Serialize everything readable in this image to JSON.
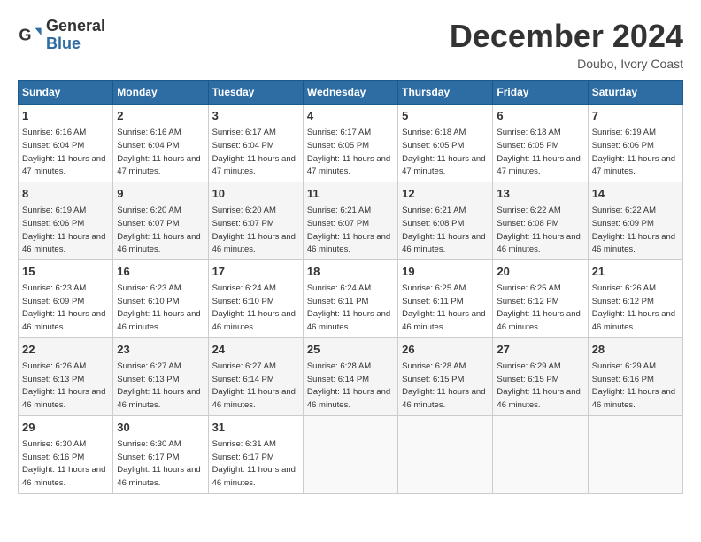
{
  "logo": {
    "line1": "General",
    "line2": "Blue"
  },
  "title": "December 2024",
  "location": "Doubo, Ivory Coast",
  "days_of_week": [
    "Sunday",
    "Monday",
    "Tuesday",
    "Wednesday",
    "Thursday",
    "Friday",
    "Saturday"
  ],
  "weeks": [
    [
      {
        "day": 1,
        "sunrise": "6:16 AM",
        "sunset": "6:04 PM",
        "daylight": "11 hours and 47 minutes."
      },
      {
        "day": 2,
        "sunrise": "6:16 AM",
        "sunset": "6:04 PM",
        "daylight": "11 hours and 47 minutes."
      },
      {
        "day": 3,
        "sunrise": "6:17 AM",
        "sunset": "6:04 PM",
        "daylight": "11 hours and 47 minutes."
      },
      {
        "day": 4,
        "sunrise": "6:17 AM",
        "sunset": "6:05 PM",
        "daylight": "11 hours and 47 minutes."
      },
      {
        "day": 5,
        "sunrise": "6:18 AM",
        "sunset": "6:05 PM",
        "daylight": "11 hours and 47 minutes."
      },
      {
        "day": 6,
        "sunrise": "6:18 AM",
        "sunset": "6:05 PM",
        "daylight": "11 hours and 47 minutes."
      },
      {
        "day": 7,
        "sunrise": "6:19 AM",
        "sunset": "6:06 PM",
        "daylight": "11 hours and 47 minutes."
      }
    ],
    [
      {
        "day": 8,
        "sunrise": "6:19 AM",
        "sunset": "6:06 PM",
        "daylight": "11 hours and 46 minutes."
      },
      {
        "day": 9,
        "sunrise": "6:20 AM",
        "sunset": "6:07 PM",
        "daylight": "11 hours and 46 minutes."
      },
      {
        "day": 10,
        "sunrise": "6:20 AM",
        "sunset": "6:07 PM",
        "daylight": "11 hours and 46 minutes."
      },
      {
        "day": 11,
        "sunrise": "6:21 AM",
        "sunset": "6:07 PM",
        "daylight": "11 hours and 46 minutes."
      },
      {
        "day": 12,
        "sunrise": "6:21 AM",
        "sunset": "6:08 PM",
        "daylight": "11 hours and 46 minutes."
      },
      {
        "day": 13,
        "sunrise": "6:22 AM",
        "sunset": "6:08 PM",
        "daylight": "11 hours and 46 minutes."
      },
      {
        "day": 14,
        "sunrise": "6:22 AM",
        "sunset": "6:09 PM",
        "daylight": "11 hours and 46 minutes."
      }
    ],
    [
      {
        "day": 15,
        "sunrise": "6:23 AM",
        "sunset": "6:09 PM",
        "daylight": "11 hours and 46 minutes."
      },
      {
        "day": 16,
        "sunrise": "6:23 AM",
        "sunset": "6:10 PM",
        "daylight": "11 hours and 46 minutes."
      },
      {
        "day": 17,
        "sunrise": "6:24 AM",
        "sunset": "6:10 PM",
        "daylight": "11 hours and 46 minutes."
      },
      {
        "day": 18,
        "sunrise": "6:24 AM",
        "sunset": "6:11 PM",
        "daylight": "11 hours and 46 minutes."
      },
      {
        "day": 19,
        "sunrise": "6:25 AM",
        "sunset": "6:11 PM",
        "daylight": "11 hours and 46 minutes."
      },
      {
        "day": 20,
        "sunrise": "6:25 AM",
        "sunset": "6:12 PM",
        "daylight": "11 hours and 46 minutes."
      },
      {
        "day": 21,
        "sunrise": "6:26 AM",
        "sunset": "6:12 PM",
        "daylight": "11 hours and 46 minutes."
      }
    ],
    [
      {
        "day": 22,
        "sunrise": "6:26 AM",
        "sunset": "6:13 PM",
        "daylight": "11 hours and 46 minutes."
      },
      {
        "day": 23,
        "sunrise": "6:27 AM",
        "sunset": "6:13 PM",
        "daylight": "11 hours and 46 minutes."
      },
      {
        "day": 24,
        "sunrise": "6:27 AM",
        "sunset": "6:14 PM",
        "daylight": "11 hours and 46 minutes."
      },
      {
        "day": 25,
        "sunrise": "6:28 AM",
        "sunset": "6:14 PM",
        "daylight": "11 hours and 46 minutes."
      },
      {
        "day": 26,
        "sunrise": "6:28 AM",
        "sunset": "6:15 PM",
        "daylight": "11 hours and 46 minutes."
      },
      {
        "day": 27,
        "sunrise": "6:29 AM",
        "sunset": "6:15 PM",
        "daylight": "11 hours and 46 minutes."
      },
      {
        "day": 28,
        "sunrise": "6:29 AM",
        "sunset": "6:16 PM",
        "daylight": "11 hours and 46 minutes."
      }
    ],
    [
      {
        "day": 29,
        "sunrise": "6:30 AM",
        "sunset": "6:16 PM",
        "daylight": "11 hours and 46 minutes."
      },
      {
        "day": 30,
        "sunrise": "6:30 AM",
        "sunset": "6:17 PM",
        "daylight": "11 hours and 46 minutes."
      },
      {
        "day": 31,
        "sunrise": "6:31 AM",
        "sunset": "6:17 PM",
        "daylight": "11 hours and 46 minutes."
      },
      null,
      null,
      null,
      null
    ]
  ]
}
